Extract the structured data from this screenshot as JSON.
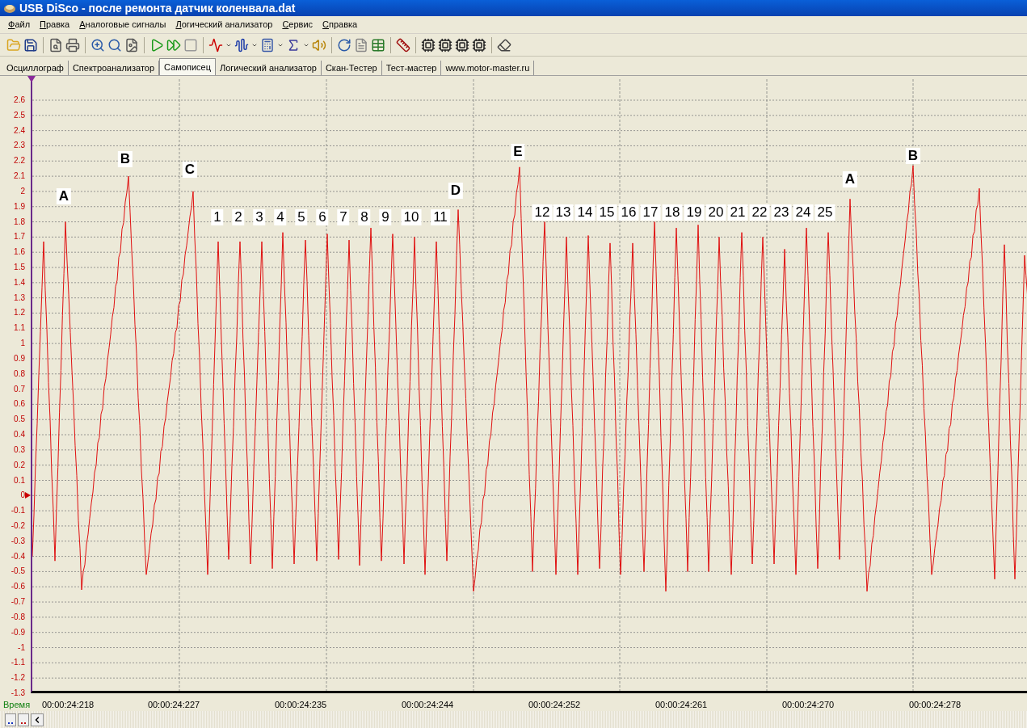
{
  "window": {
    "title": "USB DiSco - после ремонта датчик коленвала.dat"
  },
  "menu": [
    "Файл",
    "Правка",
    "Аналоговые сигналы",
    "Логический анализатор",
    "Сервис",
    "Справка"
  ],
  "tabs": [
    {
      "label": "Осциллограф",
      "selected": false
    },
    {
      "label": "Спектроанализатор",
      "selected": false
    },
    {
      "label": "Самописец",
      "selected": true
    },
    {
      "label": "Логический анализатор",
      "selected": false
    },
    {
      "label": "Скан-Тестер",
      "selected": false
    },
    {
      "label": "Тест-мастер",
      "selected": false
    },
    {
      "label": "www.motor-master.ru",
      "selected": false
    }
  ],
  "chart": {
    "y_ticks": [
      "2.6",
      "2.5",
      "2.4",
      "2.3",
      "2.2",
      "2.1",
      "2",
      "1.9",
      "1.8",
      "1.7",
      "1.6",
      "1.5",
      "1.4",
      "1.3",
      "1.2",
      "1.1",
      "1",
      "0.9",
      "0.8",
      "0.7",
      "0.6",
      "0.5",
      "0.4",
      "0.3",
      "0.2",
      "0.1",
      "0",
      "-0.1",
      "-0.2",
      "-0.3",
      "-0.4",
      "-0.5",
      "-0.6",
      "-0.7",
      "-0.8",
      "-0.9",
      "-1",
      "-1.1",
      "-1.2",
      "-1.3"
    ],
    "x_axis_label": "Время",
    "x_ticks": [
      "00:00:24:218",
      "00:00:24:227",
      "00:00:24:235",
      "00:00:24:244",
      "00:00:24:252",
      "00:00:24:261",
      "00:00:24:270",
      "00:00:24:278"
    ],
    "annotations": [
      "A",
      "B",
      "C",
      "1",
      "2",
      "3",
      "4",
      "5",
      "6",
      "7",
      "8",
      "9",
      "10",
      "11",
      "D",
      "E",
      "12",
      "13",
      "14",
      "15",
      "16",
      "17",
      "18",
      "19",
      "20",
      "21",
      "22",
      "23",
      "24",
      "25",
      "A",
      "B"
    ]
  }
}
